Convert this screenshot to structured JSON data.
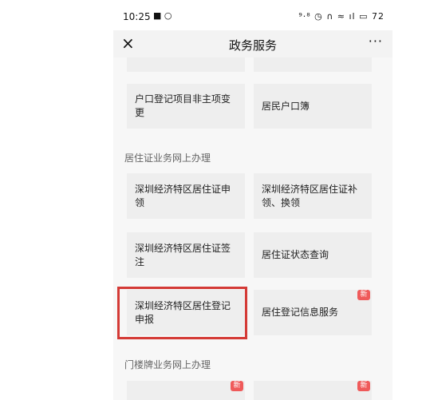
{
  "status_bar": {
    "time": "10:25",
    "left_icons": "■ ○",
    "right_icons": "⁹·⁸ ◷ ∩ ≈ ıl ▭",
    "battery": "72"
  },
  "header": {
    "close": "×",
    "title": "政务服务",
    "more": "···"
  },
  "top_cards": [
    {
      "label": "户口登记项目非主项变更"
    },
    {
      "label": "居民户口簿"
    }
  ],
  "sections": [
    {
      "title": "居住证业务网上办理",
      "cards": [
        {
          "label": "深圳经济特区居住证申领"
        },
        {
          "label": "深圳经济特区居住证补领、换领"
        },
        {
          "label": "深圳经济特区居住证签注"
        },
        {
          "label": "居住证状态查询"
        },
        {
          "label": "深圳经济特区居住登记申报",
          "highlighted": true
        },
        {
          "label": "居住登记信息服务",
          "badge": "新"
        }
      ]
    },
    {
      "title": "门楼牌业务网上办理",
      "cards": [
        {
          "label": "",
          "badge": "新"
        },
        {
          "label": "",
          "badge": "新"
        }
      ]
    }
  ],
  "colors": {
    "highlight": "#d43a36",
    "badge": "#ef5a5a",
    "card": "#eeeeee"
  }
}
